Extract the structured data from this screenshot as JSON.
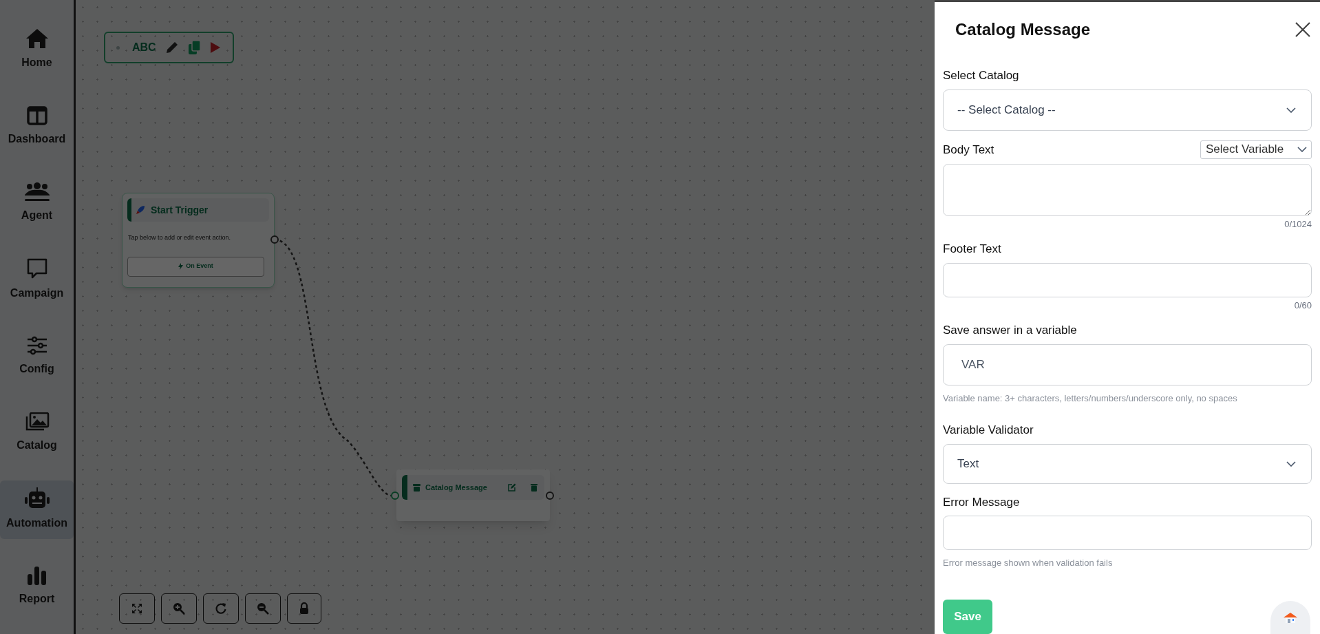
{
  "sidebar": {
    "items": [
      {
        "label": "Home",
        "selected": false
      },
      {
        "label": "Dashboard",
        "selected": false
      },
      {
        "label": "Agent",
        "selected": false
      },
      {
        "label": "Campaign",
        "selected": false
      },
      {
        "label": "Config",
        "selected": false
      },
      {
        "label": "Catalog",
        "selected": false
      },
      {
        "label": "Automation",
        "selected": true
      },
      {
        "label": "Report",
        "selected": false
      }
    ]
  },
  "toolbar": {
    "label": "ABC"
  },
  "flow": {
    "nodes": [
      {
        "kind": "trigger",
        "title": "Start Trigger",
        "description": "Tap below to add or edit event action.",
        "button": "On Event"
      },
      {
        "kind": "message",
        "title": "Catalog Message"
      }
    ]
  },
  "panel": {
    "title": "Catalog Message",
    "fields": [
      {
        "kind": "select",
        "label": "Select Catalog",
        "value": "-- Select Catalog --"
      },
      {
        "kind": "textarea",
        "label": "Body Text",
        "variable_picker": "Select Variable",
        "counter": "0/1024"
      },
      {
        "kind": "input",
        "label": "Footer Text",
        "counter": "0/60"
      },
      {
        "kind": "input",
        "label": "Save answer in a variable",
        "value": "VAR",
        "hint": "Variable name: 3+ characters, letters/numbers/underscore only, no spaces"
      },
      {
        "kind": "select",
        "label": "Variable Validator",
        "value": "Text"
      },
      {
        "kind": "input",
        "label": "Error Message",
        "hint": "Error message shown when validation fails"
      }
    ],
    "save_button": "Save"
  }
}
